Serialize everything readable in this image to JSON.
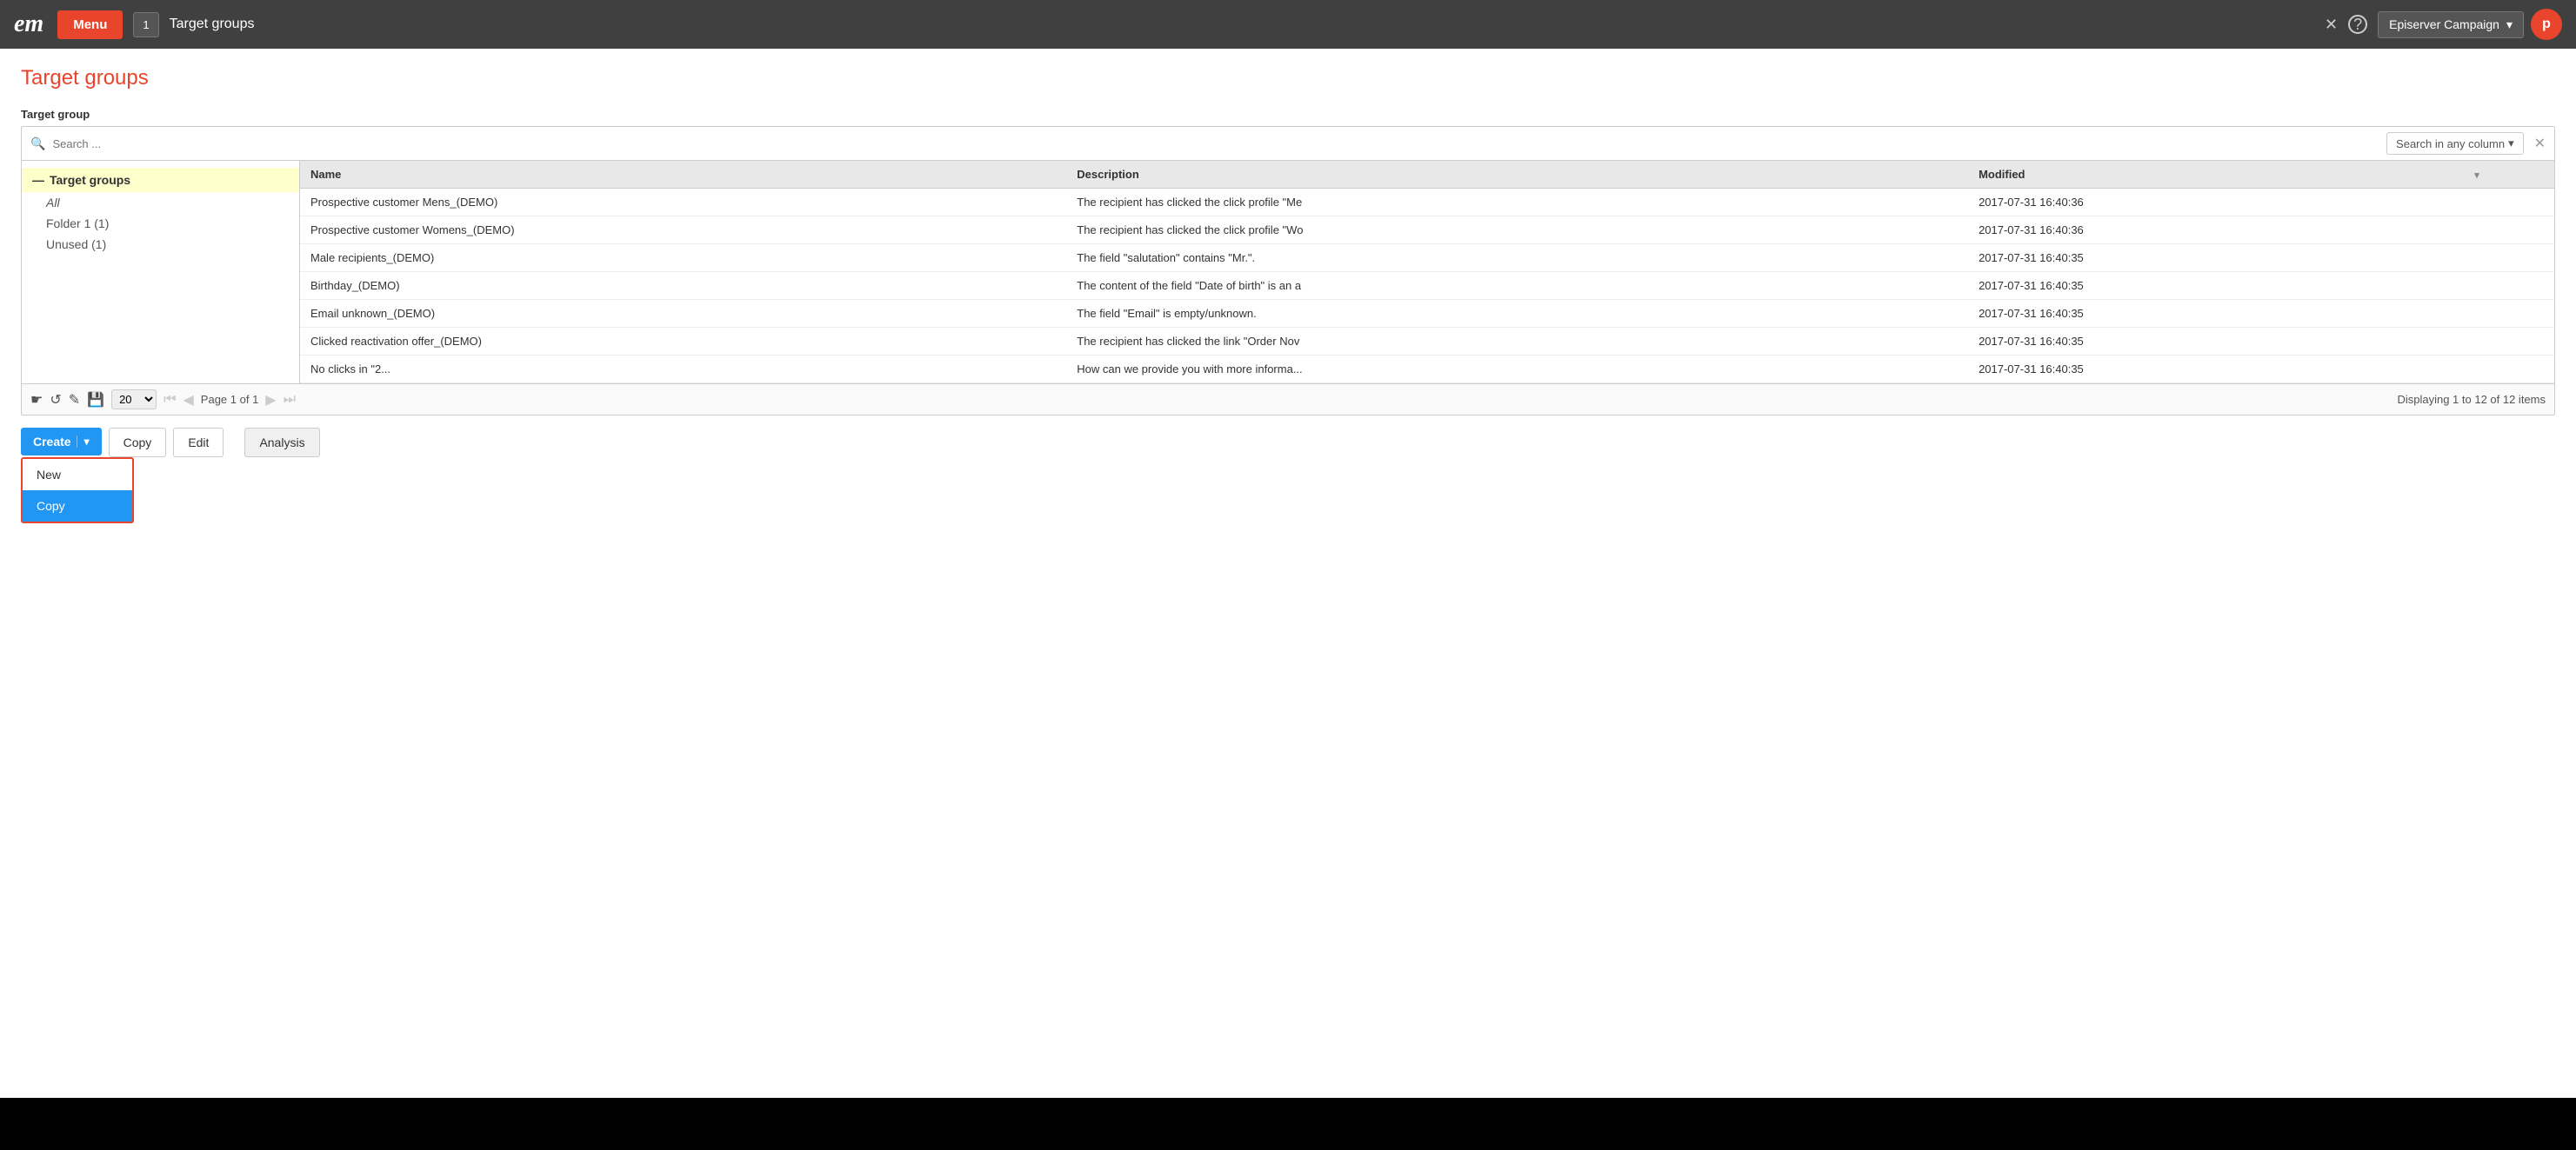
{
  "navbar": {
    "logo": "em",
    "menu_label": "Menu",
    "tab_number": "1",
    "tab_title": "Target groups",
    "close_icon": "✕",
    "help_icon": "?",
    "campaign_select": "Episerver Campaign",
    "avatar_label": "p"
  },
  "page": {
    "title": "Target groups",
    "section_label": "Target group",
    "search_placeholder": "Search ...",
    "search_any_col_placeholder": "Search in any column"
  },
  "tree": {
    "root_label": "Target groups",
    "items": [
      {
        "label": "All",
        "active": true
      },
      {
        "label": "Folder 1 (1)",
        "active": false
      },
      {
        "label": "Unused (1)",
        "active": false
      }
    ]
  },
  "table": {
    "columns": [
      {
        "key": "name",
        "label": "Name"
      },
      {
        "key": "description",
        "label": "Description"
      },
      {
        "key": "modified",
        "label": "Modified"
      }
    ],
    "rows": [
      {
        "name": "Prospective customer Mens_(DEMO)",
        "description": "The recipient has clicked the click profile \"Me",
        "modified": "2017-07-31 16:40:36"
      },
      {
        "name": "Prospective customer Womens_(DEMO)",
        "description": "The recipient has clicked the click profile \"Wo",
        "modified": "2017-07-31 16:40:36"
      },
      {
        "name": "Male recipients_(DEMO)",
        "description": "The field \"salutation\" contains \"Mr.\".",
        "modified": "2017-07-31 16:40:35"
      },
      {
        "name": "Birthday_(DEMO)",
        "description": "The content of the field \"Date of birth\" is an a",
        "modified": "2017-07-31 16:40:35"
      },
      {
        "name": "Email unknown_(DEMO)",
        "description": "The field \"Email\" is empty/unknown.",
        "modified": "2017-07-31 16:40:35"
      },
      {
        "name": "Clicked reactivation offer_(DEMO)",
        "description": "The recipient has clicked the link \"Order Nov",
        "modified": "2017-07-31 16:40:35"
      },
      {
        "name": "No clicks in \"2...",
        "description": "How can we provide you with more informa...",
        "modified": "2017-07-31 16:40:35"
      }
    ]
  },
  "pagination": {
    "per_page": "20",
    "page_text": "Page 1 of 1",
    "display_text": "Displaying 1 to 12 of 12 items"
  },
  "toolbar": {
    "create_label": "Create",
    "copy_label": "Copy",
    "edit_label": "Edit",
    "analysis_label": "Analysis",
    "dropdown_new_label": "New",
    "dropdown_copy_label": "Copy"
  },
  "tree_icons": {
    "folder": "▸",
    "minus": "—"
  }
}
